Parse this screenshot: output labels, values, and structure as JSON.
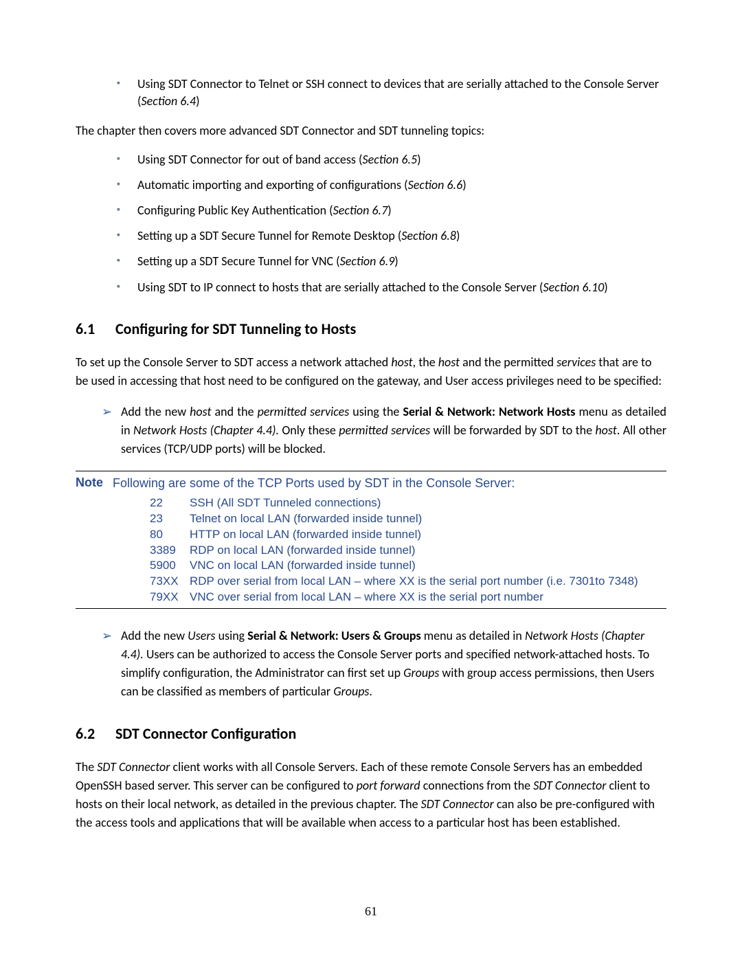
{
  "top_bullets": [
    {
      "text": "Using SDT Connector to Telnet or SSH connect to devices that are serially attached to the Console Server (",
      "section": "Section 6.4",
      "after": ")"
    }
  ],
  "chapter_intro": "The chapter then covers more advanced SDT Connector and SDT tunneling topics:",
  "advanced_bullets": [
    {
      "text": "Using SDT Connector for out of band access (",
      "section": "Section 6.5",
      "after": ")"
    },
    {
      "text": "Automatic importing and exporting of configurations (",
      "section": "Section 6.6",
      "after": ")"
    },
    {
      "text": "Configuring Public Key Authentication (",
      "section": "Section 6.7",
      "after": ")"
    },
    {
      "text": "Setting up a SDT Secure Tunnel for Remote Desktop (",
      "section": "Section 6.8",
      "after": ")"
    },
    {
      "text": "Setting up a SDT Secure Tunnel for VNC (",
      "section": "Section 6.9",
      "after": ")"
    },
    {
      "text": "Using SDT to IP connect to hosts that are serially attached to the Console Server (",
      "section": "Section 6.10",
      "after": ")"
    }
  ],
  "section_61": {
    "number": "6.1",
    "title": "Configuring for SDT Tunneling to Hosts",
    "para_parts": [
      {
        "t": "To set up the Console Server to SDT access a network attached "
      },
      {
        "t": "host",
        "i": true
      },
      {
        "t": ", the "
      },
      {
        "t": "host",
        "i": true
      },
      {
        "t": " and the permitted "
      },
      {
        "t": "services",
        "i": true
      },
      {
        "t": " that are to be used in accessing that host need to be configured on the gateway, and User access privileges need to be specified:"
      }
    ],
    "arrow1": [
      {
        "t": "Add the new "
      },
      {
        "t": "host",
        "i": true
      },
      {
        "t": " and the "
      },
      {
        "t": "permitted services",
        "i": true
      },
      {
        "t": " using the "
      },
      {
        "t": "Serial & Network: Network Hosts",
        "b": true
      },
      {
        "t": " menu as detailed in "
      },
      {
        "t": "Network Hosts (Chapter 4.4).",
        "i": true
      },
      {
        "t": " Only these "
      },
      {
        "t": "permitted services",
        "i": true
      },
      {
        "t": " will be forwarded by SDT to the "
      },
      {
        "t": "host",
        "i": true
      },
      {
        "t": ". All other services (TCP/UDP ports) will be blocked."
      }
    ],
    "arrow2": [
      {
        "t": "Add the new "
      },
      {
        "t": "Users",
        "i": true
      },
      {
        "t": " using "
      },
      {
        "t": "Serial & Network: Users & Groups",
        "b": true
      },
      {
        "t": " menu as detailed in "
      },
      {
        "t": "Network Hosts (Chapter 4.4).",
        "i": true
      },
      {
        "t": " Users can be authorized to access the Console Server ports and specified network-attached hosts. To simplify configuration, the Administrator can first set up "
      },
      {
        "t": "Groups",
        "i": true
      },
      {
        "t": " with group access permissions, then Users can be classified as members of particular "
      },
      {
        "t": "Groups",
        "i": true
      },
      {
        "t": "."
      }
    ]
  },
  "note": {
    "label": "Note",
    "intro": "Following are some of the TCP Ports used by SDT in the Console Server:",
    "ports": [
      {
        "num": "22",
        "desc": "SSH (All SDT Tunneled connections)"
      },
      {
        "num": "23",
        "desc": "Telnet on local LAN (forwarded inside tunnel)"
      },
      {
        "num": "80",
        "desc": "HTTP on local LAN (forwarded inside tunnel)"
      },
      {
        "num": "3389",
        "desc": "RDP on local LAN (forwarded inside tunnel)"
      },
      {
        "num": "5900",
        "desc": "VNC on local LAN (forwarded inside tunnel)"
      },
      {
        "num": "73XX",
        "desc": "RDP over serial from local LAN – where XX is the serial port number (i.e. 7301to 7348)"
      },
      {
        "num": "79XX",
        "desc": "VNC over serial from local LAN – where XX is the serial port number"
      }
    ]
  },
  "section_62": {
    "number": "6.2",
    "title": "SDT Connector Configuration",
    "para_parts": [
      {
        "t": "The "
      },
      {
        "t": "SDT Connector",
        "i": true
      },
      {
        "t": " client works with all Console Servers. Each of these remote Console Servers has an embedded OpenSSH based server. This server can be configured to "
      },
      {
        "t": "port forward",
        "i": true
      },
      {
        "t": " connections from the "
      },
      {
        "t": "SDT Connector",
        "i": true
      },
      {
        "t": " client to hosts on their local network, as detailed in the previous chapter. The "
      },
      {
        "t": "SDT Connector",
        "i": true
      },
      {
        "t": " can also be pre-configured with the access tools and applications that will be available when access to a particular host has been established."
      }
    ]
  },
  "page_number": "61"
}
